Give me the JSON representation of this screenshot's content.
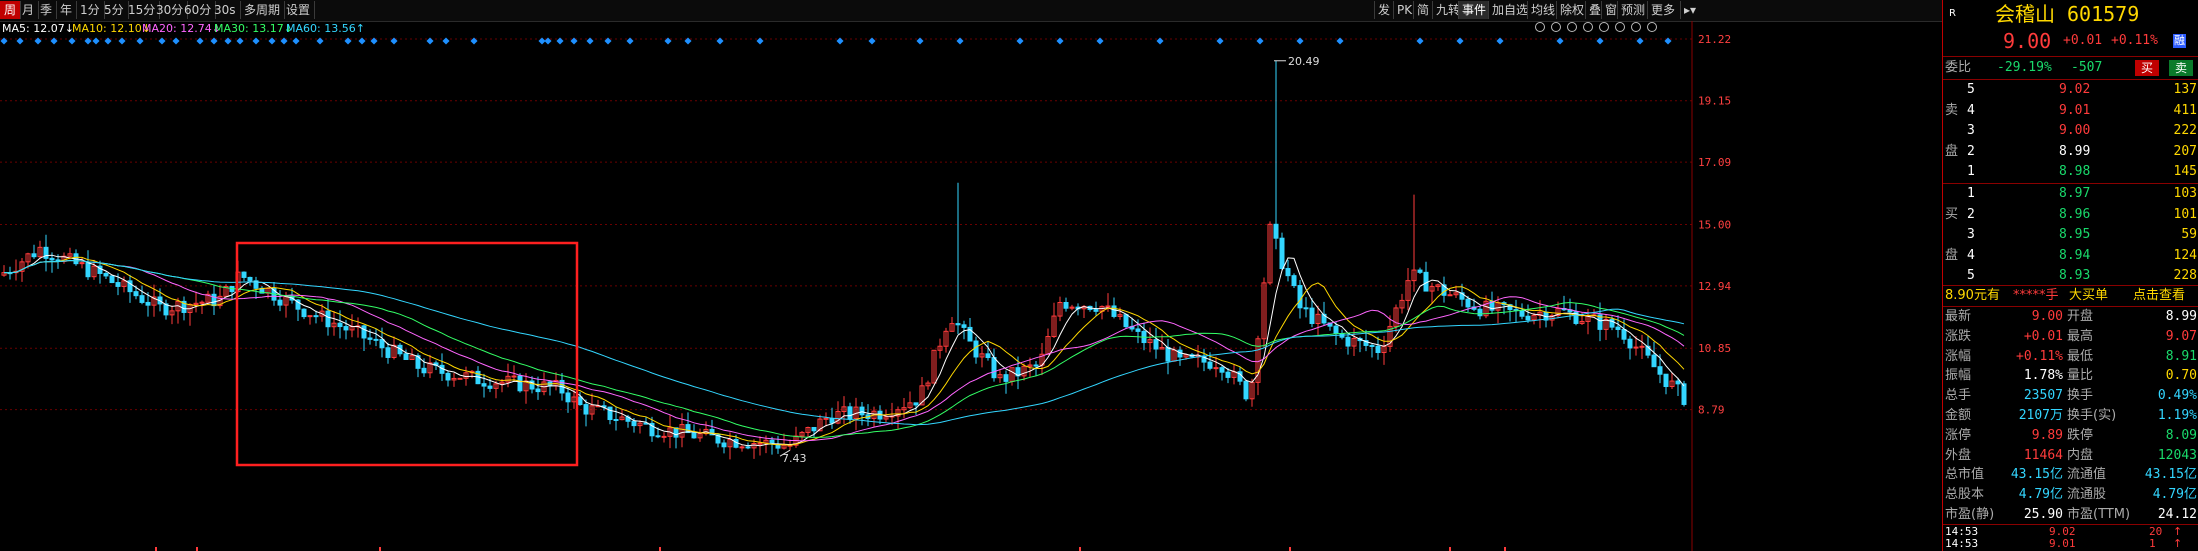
{
  "toolbar": {
    "periods": [
      "周",
      "月",
      "季",
      "年",
      "1分",
      "5分",
      "15分",
      "30分",
      "60分",
      "30s",
      "多周期",
      "设置"
    ],
    "active_period": "周",
    "right_buttons": [
      "发",
      "PK",
      "简",
      "九转",
      "事件",
      "加自选",
      "均线",
      "除权",
      "叠",
      "窗",
      "预测",
      "更多"
    ],
    "active_right": "事件",
    "icons": [
      "eye-icon",
      "settings-gear-icon",
      "lock-icon",
      "undo-icon",
      "redo-icon",
      "scissors-icon",
      "zoom-in-icon",
      "zoom-out-icon"
    ]
  },
  "ma_legend": [
    {
      "label": "MA5: 12.07",
      "arrow": "↓",
      "color": "#ffffff"
    },
    {
      "label": "MA10: 12.10",
      "arrow": "↓",
      "color": "#ffd800"
    },
    {
      "label": "MA20: 12.74",
      "arrow": "↓",
      "color": "#ff66ff"
    },
    {
      "label": "MA30: 13.17",
      "arrow": "↓",
      "color": "#33ff66"
    },
    {
      "label": "MA60: 13.56",
      "arrow": "↑",
      "color": "#33d6ff"
    }
  ],
  "chart_data": {
    "type": "candlestick",
    "y_axis_ticks": [
      "21.22",
      "19.15",
      "17.09",
      "15.00",
      "12.94",
      "10.85",
      "8.79"
    ],
    "ylim": [
      6.9,
      21.22
    ],
    "annotations": {
      "high": "20.49",
      "low": "7.43"
    }
  },
  "stock": {
    "r_label": "R",
    "name": "会稽山",
    "code": "601579",
    "price": "9.00",
    "change": "+0.01",
    "change_pct": "+0.11%",
    "tag": "融"
  },
  "weibi": {
    "label": "委比",
    "pct": "-29.19%",
    "diff": "-507",
    "buy": "买",
    "sell": "卖"
  },
  "sell_orders": [
    {
      "side": "",
      "level": "5",
      "price": "9.02",
      "vol": "137"
    },
    {
      "side": "卖",
      "level": "4",
      "price": "9.01",
      "vol": "411"
    },
    {
      "side": "",
      "level": "3",
      "price": "9.00",
      "vol": "222"
    },
    {
      "side": "盘",
      "level": "2",
      "price": "8.99",
      "vol": "207"
    },
    {
      "side": "",
      "level": "1",
      "price": "8.98",
      "vol": "145"
    }
  ],
  "buy_orders": [
    {
      "side": "",
      "level": "1",
      "price": "8.97",
      "vol": "103"
    },
    {
      "side": "买",
      "level": "2",
      "price": "8.96",
      "vol": "101"
    },
    {
      "side": "",
      "level": "3",
      "price": "8.95",
      "vol": "59"
    },
    {
      "side": "盘",
      "level": "4",
      "price": "8.94",
      "vol": "124"
    },
    {
      "side": "",
      "level": "5",
      "price": "8.93",
      "vol": "228"
    }
  ],
  "big_order": {
    "price": "8.90元有",
    "mask": "*****手",
    "label": "大买单",
    "link": "点击查看"
  },
  "quote": [
    {
      "l": "最新",
      "lv": "9.00",
      "r": "开盘",
      "rv": "8.99",
      "lc": "red",
      "rc": "white"
    },
    {
      "l": "涨跌",
      "lv": "+0.01",
      "r": "最高",
      "rv": "9.07",
      "lc": "red",
      "rc": "red"
    },
    {
      "l": "涨幅",
      "lv": "+0.11%",
      "r": "最低",
      "rv": "8.91",
      "lc": "red",
      "rc": "green"
    },
    {
      "l": "振幅",
      "lv": "1.78%",
      "r": "量比",
      "rv": "0.70",
      "lc": "white",
      "rc": "yellow"
    },
    {
      "l": "总手",
      "lv": "23507",
      "r": "换手",
      "rv": "0.49%",
      "lc": "cyan",
      "rc": "cyan"
    },
    {
      "l": "金额",
      "lv": "2107万",
      "r": "换手(实)",
      "rv": "1.19%",
      "lc": "cyan",
      "rc": "cyan"
    },
    {
      "l": "涨停",
      "lv": "9.89",
      "r": "跌停",
      "rv": "8.09",
      "lc": "red",
      "rc": "green"
    },
    {
      "l": "外盘",
      "lv": "11464",
      "r": "内盘",
      "rv": "12043",
      "lc": "red",
      "rc": "green"
    },
    {
      "l": "总市值",
      "lv": "43.15亿",
      "r": "流通值",
      "rv": "43.15亿",
      "lc": "cyan",
      "rc": "cyan"
    },
    {
      "l": "总股本",
      "lv": "4.79亿",
      "r": "流通股",
      "rv": "4.79亿",
      "lc": "cyan",
      "rc": "cyan"
    },
    {
      "l": "市盈(静)",
      "lv": "25.90",
      "r": "市盈(TTM)",
      "rv": "24.12",
      "lc": "white",
      "rc": "white"
    }
  ],
  "ticks": [
    {
      "time": "14:53",
      "price": "9.02",
      "vol": "20",
      "arrow": "↑"
    },
    {
      "time": "14:53",
      "price": "9.01",
      "vol": "1",
      "arrow": "↑"
    }
  ]
}
